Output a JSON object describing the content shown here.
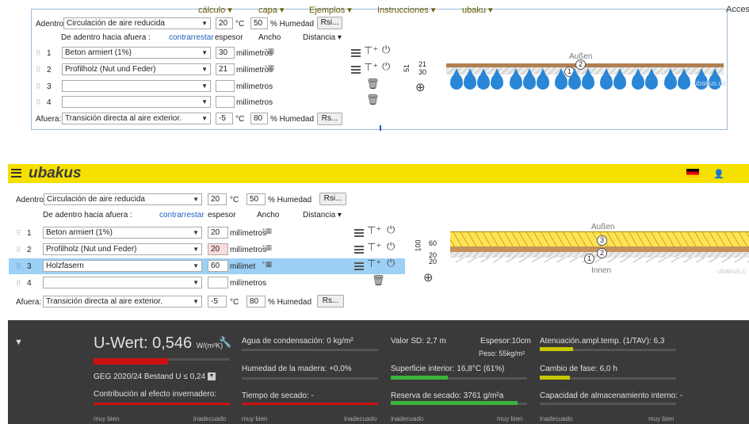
{
  "top": {
    "inside_label": "Adentro",
    "inside_select": "Circulación de aire reducida",
    "inside_temp": "20",
    "temp_unit": "°C",
    "inside_humidity": "50",
    "humidity_label": "% Humedad",
    "rsi_button": "Rsi...",
    "direction_label": "De adentro hacia afuera :",
    "reverse_link": "contrarrestar",
    "thickness_header": "espesor",
    "width_header": "Ancho",
    "distance_header": "Distancia ▾",
    "rows": [
      {
        "num": "1",
        "material": "Beton armiert (1%)",
        "thickness": "30",
        "unit": "milímetros"
      },
      {
        "num": "2",
        "material": "Profilholz (Nut und Feder)",
        "thickness": "21",
        "unit": "milímetros"
      },
      {
        "num": "3",
        "material": "",
        "thickness": "",
        "unit": "milímetros"
      },
      {
        "num": "4",
        "material": "",
        "thickness": "",
        "unit": "milímetros"
      }
    ],
    "outside_label": "Afuera:",
    "outside_select": "Transición directa al aire exterior.",
    "outside_temp": "-5",
    "outside_humidity": "80",
    "rs_button": "Rs...",
    "dim_total": "51",
    "dim_a": "21",
    "dim_b": "30",
    "outside_text": "Außen",
    "watermark": "ubakus.de"
  },
  "nav": {
    "logo": "ubakus",
    "items": [
      "cálculo ▾",
      "capa ▾",
      "Ejemplos ▾",
      "Instrucciones ▾",
      "ubaku ▾"
    ],
    "access": "Acces"
  },
  "bottom": {
    "inside_label": "Adentro",
    "inside_select": "Circulación de aire reducida",
    "inside_temp": "20",
    "temp_unit": "°C",
    "inside_humidity": "50",
    "humidity_label": "% Humedad",
    "rsi_button": "Rsi...",
    "direction_label": "De adentro hacia afuera :",
    "reverse_link": "contrarrestar",
    "thickness_header": "espesor",
    "width_header": "Ancho",
    "distance_header": "Distancia ▾",
    "rows": [
      {
        "num": "1",
        "material": "Beton armiert (1%)",
        "thickness": "20",
        "unit": "milímetros"
      },
      {
        "num": "2",
        "material": "Profilholz (Nut und Feder)",
        "thickness": "20",
        "unit": "milímetros"
      },
      {
        "num": "3",
        "material": "Holzfasern",
        "thickness": "60",
        "unit": "milímet"
      },
      {
        "num": "4",
        "material": "",
        "thickness": "",
        "unit": "milímetros"
      }
    ],
    "outside_label": "Afuera:",
    "outside_select": "Transición directa al aire exterior.",
    "outside_temp": "-5",
    "outside_humidity": "80",
    "rs_button": "Rs...",
    "dim_total": "100",
    "dim_a": "60",
    "dim_b": "20",
    "dim_c": "20",
    "outside_text": "Außen",
    "inside_text": "Innen",
    "watermark": "ubakus.c"
  },
  "results": {
    "uwert_label": "U-Wert: 0,546",
    "uwert_unit": "W/(m²K)",
    "geg": "GEG 2020/24 Bestand U ≤ 0,24",
    "greenhouse": "Contribución al efecto invernadero:",
    "condensation": "Agua de condensación: 0 kg/m²",
    "wood_moisture": "Humedad de la madera: +0,0%",
    "drying_time": "Tiempo de secado: -",
    "sd_value": "Valor SD: 2,7 m",
    "thickness": "Espesor:10cm",
    "weight": "Peso: 55kg/m²",
    "surface": "Superficie interior: 16,8°C (61%)",
    "drying_reserve": "Reserva de secado: 3761 g/m²a",
    "attenuation": "Atenuación.ampl.temp. (1/TAV): 6,3",
    "phase_shift": "Cambio de fase: 6,0 h",
    "storage": "Capacidad de almacenamiento interno: -",
    "very_good": "muy bien",
    "inadequate": "inadecuado"
  },
  "colors": {
    "nav": "#f5e000",
    "dark": "#3a3a3a",
    "water": "#2a86d6",
    "selected_row": "#9cd0f5"
  }
}
